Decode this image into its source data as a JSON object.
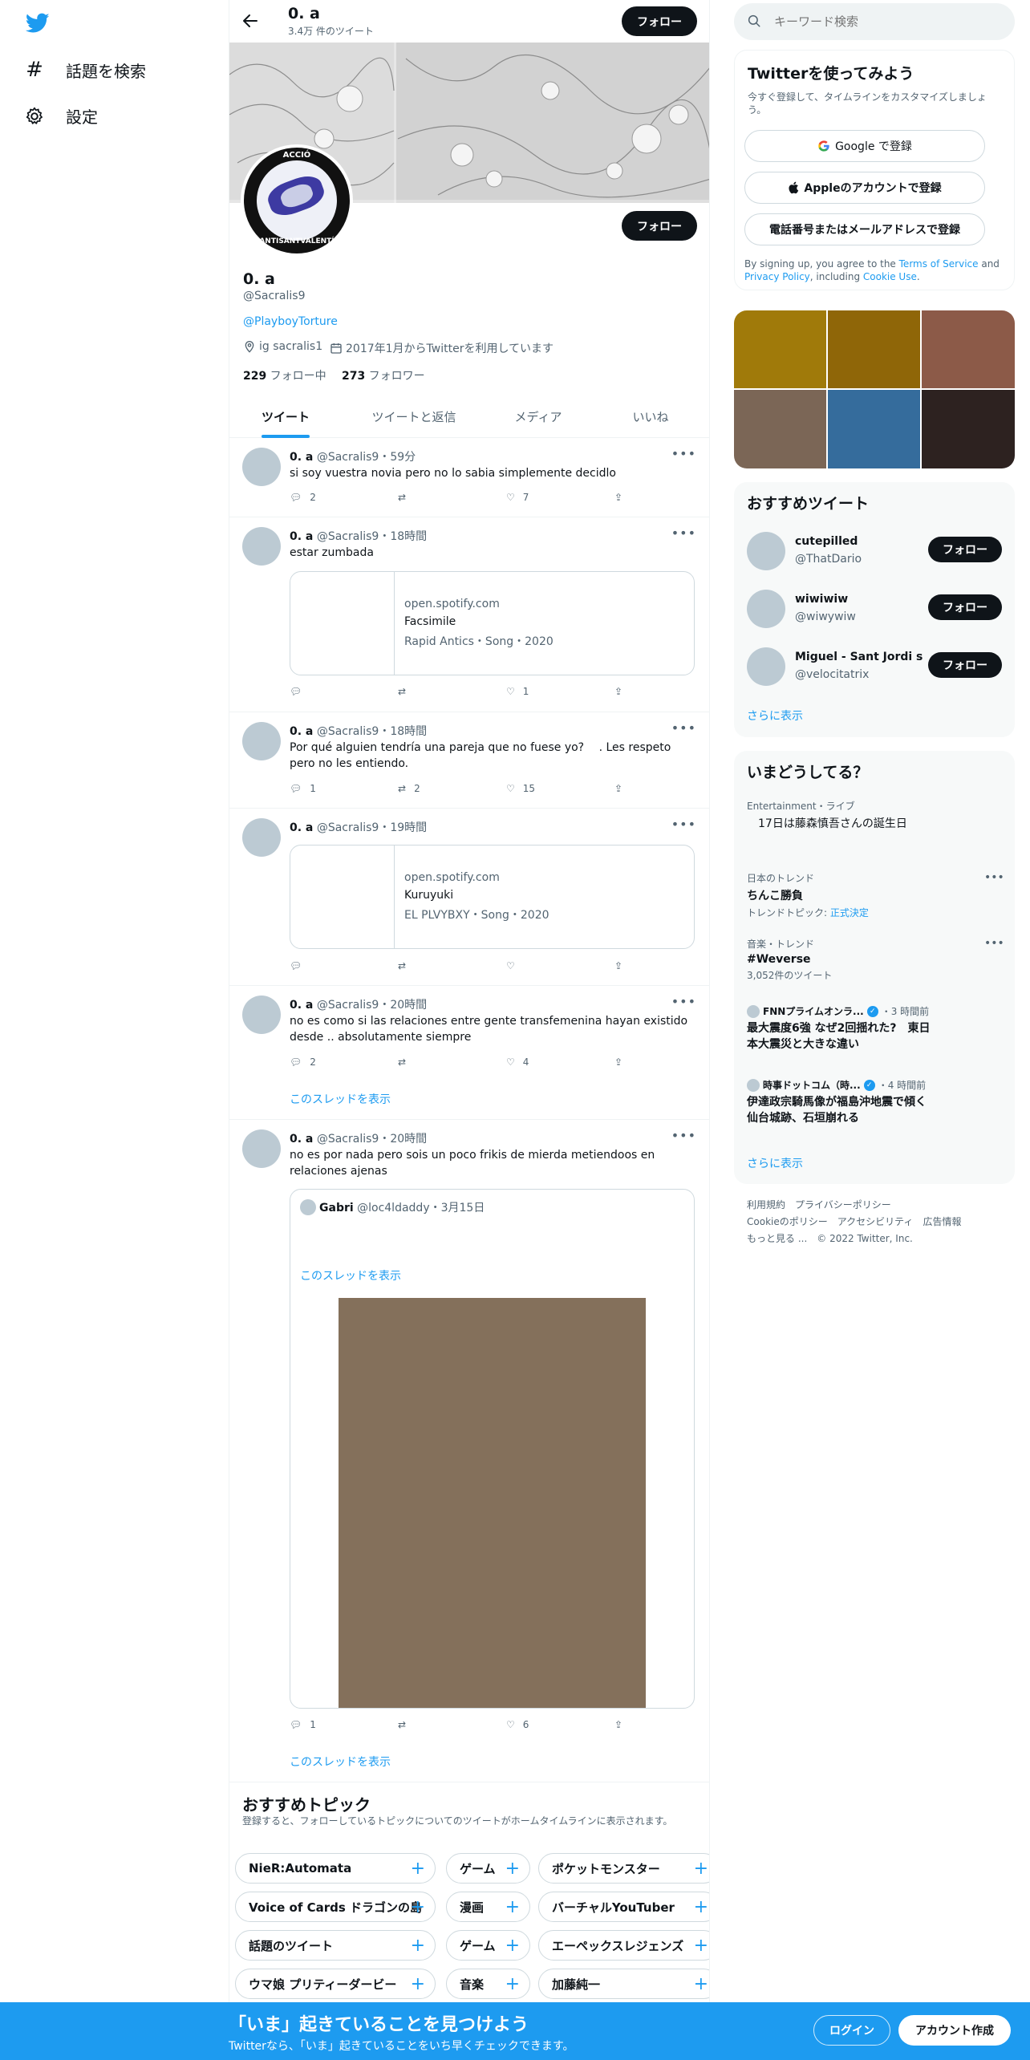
{
  "leftnav": {
    "items": [
      {
        "label": "話題を検索",
        "icon": "hashtag-icon"
      },
      {
        "label": "設定",
        "icon": "gear-icon"
      }
    ]
  },
  "header": {
    "name": "0. a",
    "tweet_count": "3.4万 件のツイート",
    "follow_label": "フォロー"
  },
  "profile": {
    "follow_label": "フォロー",
    "display_name": "0. a",
    "handle": "@Sacralis9",
    "bio_link": "@PlayboyTorture",
    "location": "ig sacralis1",
    "joined": "2017年1月からTwitterを利用しています",
    "following_count": "229",
    "following_label": " フォロー中",
    "followers_count": "273",
    "followers_label": " フォロワー",
    "avatar_text_top": "ACCIÓ",
    "avatar_text_bottom": "ANTISANTVALENTÍ"
  },
  "tabs": [
    "ツイート",
    "ツイートと返信",
    "メディア",
    "いいね"
  ],
  "tweets": [
    {
      "name": "0. a",
      "handle": "@Sacralis9",
      "time": "59分",
      "text": "si soy vuestra novia pero no lo sabia simplemente decidlo",
      "replies": "2",
      "retweets": "",
      "likes": "7"
    },
    {
      "name": "0. a",
      "handle": "@Sacralis9",
      "time": "18時間",
      "text": "estar zumbada",
      "card": {
        "domain": "open.spotify.com",
        "title": "Facsimile",
        "sub": "Rapid Antics・Song・2020"
      },
      "replies": "",
      "retweets": "",
      "likes": "1"
    },
    {
      "name": "0. a",
      "handle": "@Sacralis9",
      "time": "18時間",
      "text": "Por qué alguien tendría una pareja que no fuese yo?　 . Les respeto pero no les entiendo.",
      "replies": "1",
      "retweets": "2",
      "likes": "15"
    },
    {
      "name": "0. a",
      "handle": "@Sacralis9",
      "time": "19時間",
      "text": "",
      "card": {
        "domain": "open.spotify.com",
        "title": "Kuruyuki",
        "sub": "EL PLVYBXY・Song・2020"
      },
      "replies": "",
      "retweets": "",
      "likes": ""
    },
    {
      "name": "0. a",
      "handle": "@Sacralis9",
      "time": "20時間",
      "text": "no es como si las relaciones entre gente transfemenina hayan existido desde .. absolutamente siempre",
      "replies": "2",
      "retweets": "",
      "likes": "4",
      "thread": "このスレッドを表示"
    },
    {
      "name": "0. a",
      "handle": "@Sacralis9",
      "time": "20時間",
      "text": "no es por nada pero sois un poco frikis de mierda metiendoos en relaciones ajenas",
      "quote": {
        "name": "Gabri",
        "handle": "@loc4ldaddy",
        "time": "3月15日",
        "thread": "このスレッドを表示"
      },
      "replies": "1",
      "retweets": "",
      "likes": "6",
      "thread": "このスレッドを表示"
    }
  ],
  "topics": {
    "title": "おすすめトピック",
    "subtitle": "登録すると、フォローしているトピックについてのツイートがホームタイムラインに表示されます。",
    "rows": [
      [
        "NieR:Automata",
        "ゲーム",
        "ポケットモンスター"
      ],
      [
        "Voice of Cards ドラゴンの島",
        "漫画",
        "バーチャルYouTuber"
      ],
      [
        "話題のツイート",
        "ゲーム",
        "エーペックスレジェンズ"
      ],
      [
        "ウマ娘 プリティーダービー",
        "音楽",
        "加藤純一"
      ]
    ]
  },
  "search": {
    "placeholder": "キーワード検索"
  },
  "signup": {
    "title": "Twitterを使ってみよう",
    "subtitle": "今すぐ登録して、タイムラインをカスタマイズしましょう。",
    "google": "Google で登録",
    "apple": "Appleのアカウントで登録",
    "phone": "電話番号またはメールアドレスで登録",
    "terms_pre": "By signing up, you agree to the ",
    "terms_link": "Terms of Service",
    "terms_and": " and ",
    "privacy_link": "Privacy Policy",
    "terms_incl": ", including ",
    "cookie_link": "Cookie Use",
    "terms_end": "."
  },
  "media_colors": [
    "#a07a0a",
    "#8f6608",
    "#8c5a48",
    "#7b6656",
    "#356c9c",
    "#2d2220"
  ],
  "recommended": {
    "title": "おすすめツイート",
    "users": [
      {
        "name": "cutepilled",
        "handle": "@ThatDario"
      },
      {
        "name": "wiwiwiw",
        "handle": "@wiwywiw"
      },
      {
        "name": "Miguel - Sant Jordi s...",
        "handle": "@velocitatrix"
      }
    ],
    "follow_label": "フォロー",
    "more": "さらに表示"
  },
  "trends": {
    "title": "いまどうしてる？",
    "items": [
      {
        "meta": "Entertainment・ライブ",
        "title": "　17日は藤森慎吾さんの誕生日"
      },
      {
        "meta": "日本のトレンド",
        "title": "ちんこ勝負",
        "topic_label": "トレンドトピック: ",
        "topic": "正式決定"
      },
      {
        "meta": "音楽・トレンド",
        "title": "#Weverse",
        "count": "3,052件のツイート"
      },
      {
        "source": "FNNプライムオンラ...",
        "time": "・3 時間前",
        "title": "最大震度6強 なぜ2回揺れた?　東日本大震災と大きな違い"
      },
      {
        "source": "時事ドットコム（時...",
        "time": "・4 時間前",
        "title": "伊達政宗騎馬像が福島沖地震で傾く　仙台城跡、石垣崩れる"
      }
    ],
    "more": "さらに表示"
  },
  "footer": {
    "links": [
      "利用規約",
      "プライバシーポリシー",
      "Cookieのポリシー",
      "アクセシビリティ",
      "広告情報",
      "もっと見る ..."
    ],
    "copyright": "© 2022 Twitter, Inc."
  },
  "bottombar": {
    "title": "「いま」起きていることを見つけよう",
    "subtitle": "Twitterなら、「いま」起きていることをいち早くチェックできます。",
    "login": "ログイン",
    "signup": "アカウント作成"
  },
  "colors": {
    "accent": "#1d9bf0",
    "text": "#0f1419",
    "muted": "#536471",
    "media_placeholder": "#84705b"
  }
}
